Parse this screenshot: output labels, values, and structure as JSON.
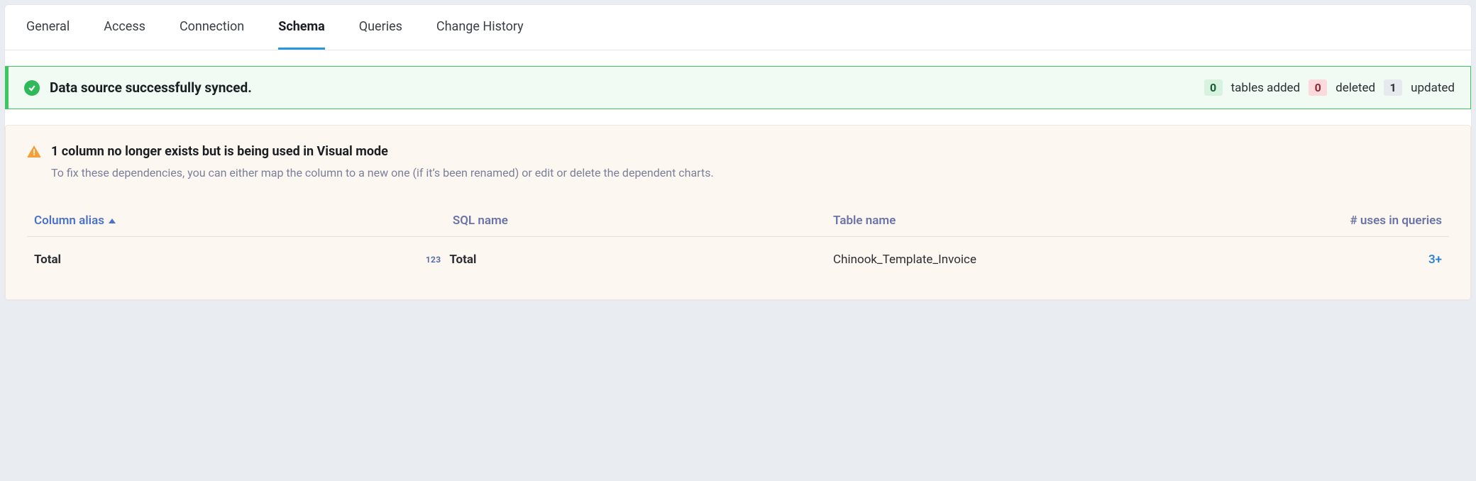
{
  "tabs": {
    "general": "General",
    "access": "Access",
    "connection": "Connection",
    "schema": "Schema",
    "queries": "Queries",
    "change_history": "Change History"
  },
  "sync_alert": {
    "title": "Data source successfully synced.",
    "added_count": "0",
    "added_label": "tables added",
    "deleted_count": "0",
    "deleted_label": "deleted",
    "updated_count": "1",
    "updated_label": "updated"
  },
  "warning": {
    "title": "1 column no longer exists but is being used in Visual mode",
    "subtitle": "To fix these dependencies, you can either map the column to a new one (if it’s been renamed) or edit or delete the dependent charts."
  },
  "columns_table": {
    "headers": {
      "alias": "Column alias",
      "sql": "SQL name",
      "table": "Table name",
      "uses": "# uses in queries"
    },
    "row": {
      "alias": "Total",
      "type_badge": "123",
      "sql": "Total",
      "table": "Chinook_Template_Invoice",
      "uses": "3+"
    }
  }
}
